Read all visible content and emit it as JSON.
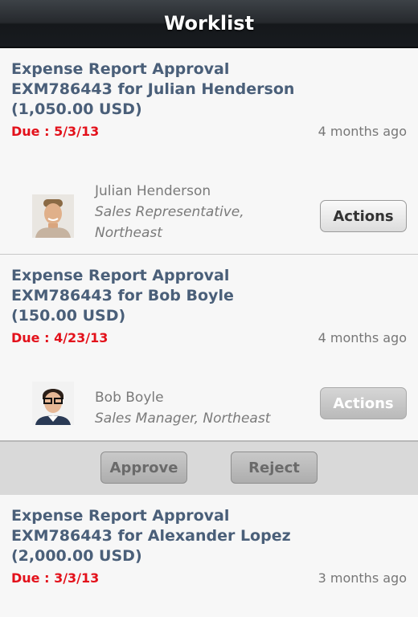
{
  "header": {
    "title": "Worklist"
  },
  "items": [
    {
      "title": "Expense Report Approval EXM786443 for Julian Henderson (1,050.00 USD)",
      "due": "Due : 5/3/13",
      "age": "4 months ago",
      "person": {
        "name": "Julian Henderson",
        "role": "Sales Representative, Northeast"
      },
      "action_label": "Actions"
    },
    {
      "title": "Expense Report Approval EXM786443 for Bob Boyle (150.00 USD)",
      "due": "Due : 4/23/13",
      "age": "4 months ago",
      "person": {
        "name": "Bob Boyle",
        "role": "Sales Manager, Northeast"
      },
      "action_label": "Actions"
    },
    {
      "title": "Expense Report Approval EXM786443 for Alexander Lopez (2,000.00 USD)",
      "due": "Due : 3/3/13",
      "age": "3 months ago"
    }
  ],
  "action_bar": {
    "approve_label": "Approve",
    "reject_label": "Reject"
  },
  "colors": {
    "title": "#4a5f79",
    "due": "#e3111b",
    "header_bg": "#26292d"
  },
  "icons": {
    "avatar_1": "person-photo",
    "avatar_2": "person-photo"
  }
}
